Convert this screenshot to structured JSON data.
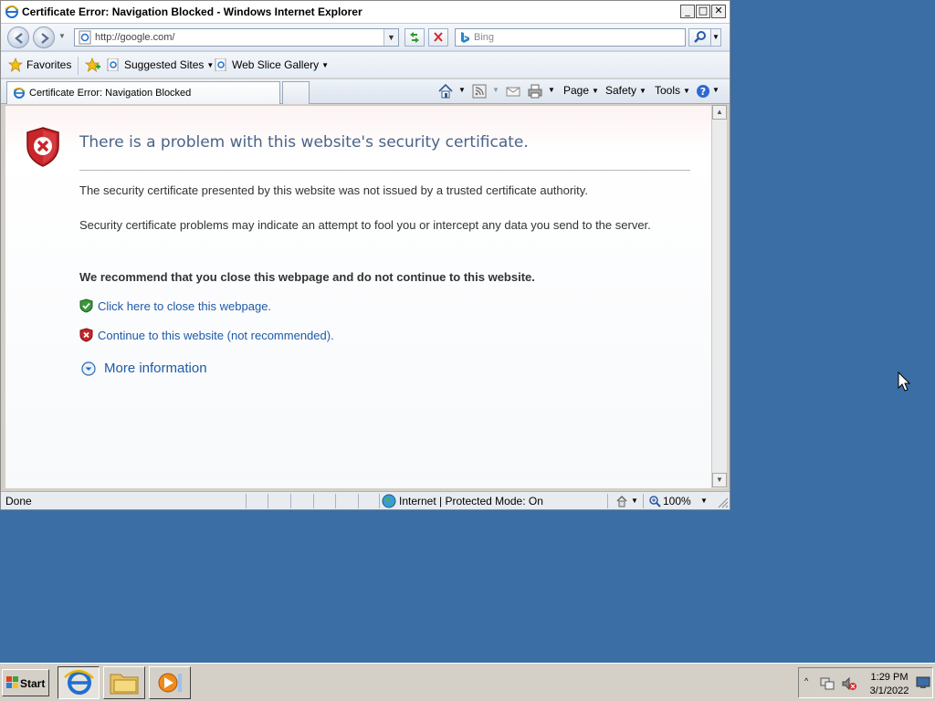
{
  "window": {
    "title": "Certificate Error: Navigation Blocked - Windows Internet Explorer",
    "controls": {
      "minimize": "_",
      "maximize": "□",
      "close": "✕"
    }
  },
  "navbar": {
    "url": "http://google.com/",
    "search_placeholder": "Bing"
  },
  "favorites_bar": {
    "favorites_label": "Favorites",
    "items": [
      {
        "label": "Suggested Sites"
      },
      {
        "label": "Web Slice Gallery"
      }
    ]
  },
  "tab": {
    "label": "Certificate Error: Navigation Blocked"
  },
  "command_bar": {
    "page": "Page",
    "safety": "Safety",
    "tools": "Tools"
  },
  "content": {
    "title": "There is a problem with this website's security certificate.",
    "paragraph1": "The security certificate presented by this website was not issued by a trusted certificate authority.",
    "paragraph2": "Security certificate problems may indicate an attempt to fool you or intercept any data you send to the server.",
    "recommendation": "We recommend that you close this webpage and do not continue to this website.",
    "close_link": "Click here to close this webpage.",
    "continue_link": "Continue to this website (not recommended).",
    "more_info": "More information"
  },
  "statusbar": {
    "status": "Done",
    "zone": "Internet | Protected Mode: On",
    "zoom": "100%"
  },
  "taskbar": {
    "start_label": "Start",
    "apps": [
      "internet-explorer",
      "windows-explorer",
      "windows-media-player"
    ],
    "time": "1:29 PM",
    "date": "3/1/2022"
  },
  "colors": {
    "desktop": "#3a6ea5",
    "link": "#1e5aa8",
    "title_text": "#4a6488",
    "error_red": "#c8262b",
    "safe_green": "#3a9a3a"
  }
}
